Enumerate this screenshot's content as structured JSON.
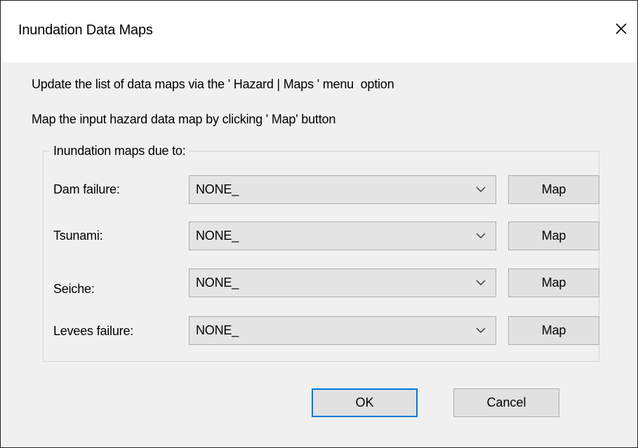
{
  "window": {
    "title": "Inundation Data Maps",
    "close_icon": "close-icon"
  },
  "instructions": {
    "line1": "Update the list of data maps via the ' Hazard | Maps ' menu  option",
    "line2": "Map the input hazard data map by clicking ' Map' button"
  },
  "group": {
    "legend": "Inundation maps due to:",
    "rows": [
      {
        "label": "Dam failure:",
        "selected": "NONE_",
        "button": "Map"
      },
      {
        "label": "Tsunami:",
        "selected": "NONE_",
        "button": "Map"
      },
      {
        "label": "Seiche:",
        "selected": "NONE_",
        "button": "Map"
      },
      {
        "label": "Levees failure:",
        "selected": "NONE_",
        "button": "Map"
      }
    ]
  },
  "buttons": {
    "ok": "OK",
    "cancel": "Cancel"
  },
  "colors": {
    "focus_border": "#0078d7",
    "button_face": "#e1e1e1",
    "combo_face": "#e5e5e5",
    "dialog_bg": "#f0f0f0"
  }
}
